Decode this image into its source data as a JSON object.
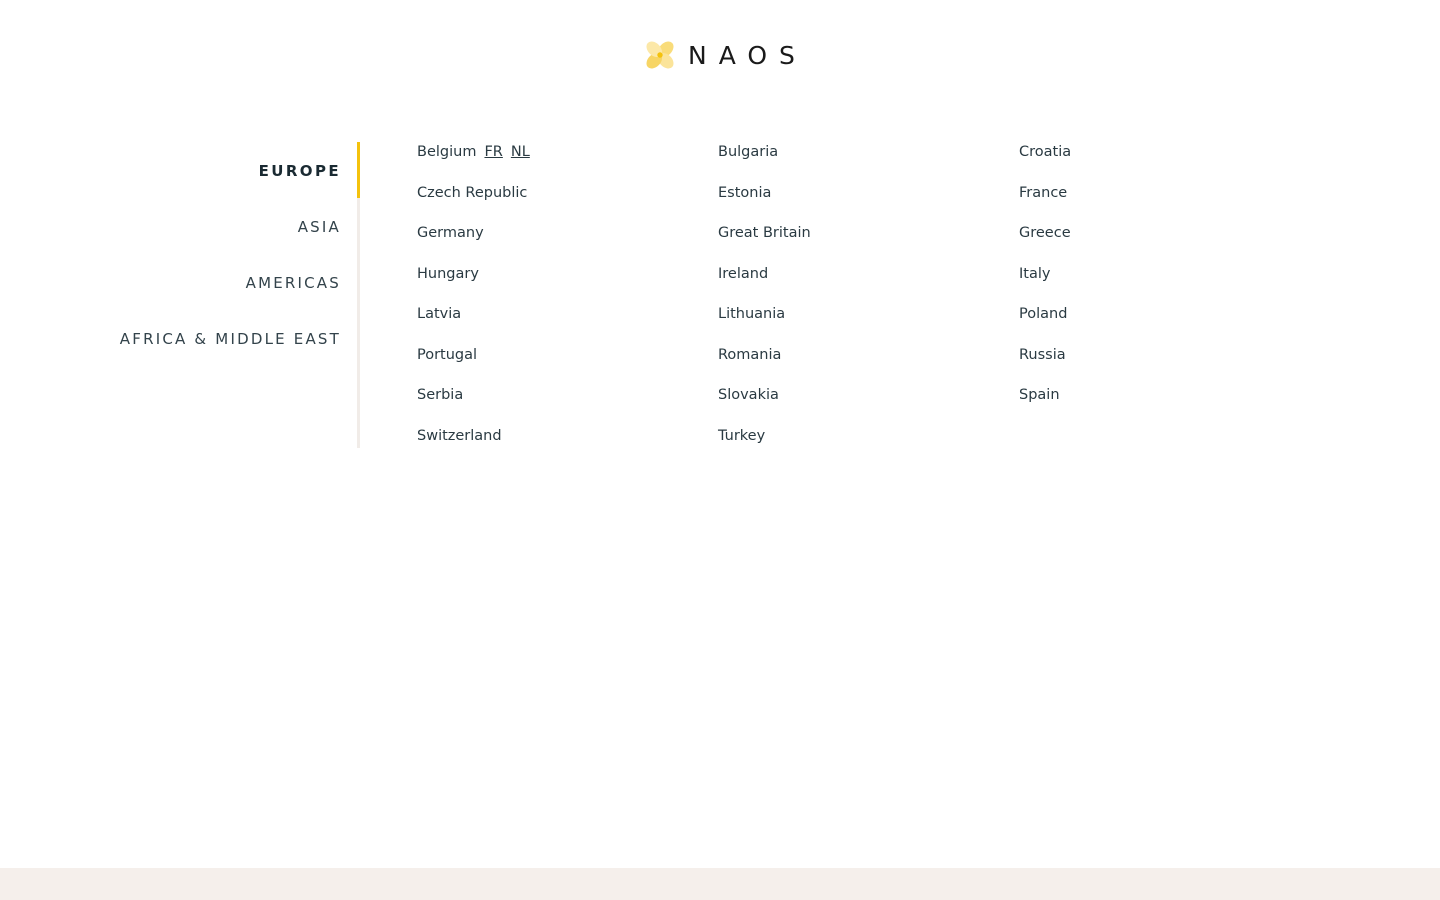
{
  "brand": {
    "name": "NAOS",
    "logo_icon": "flower-icon",
    "accent_color": "#f4c20d"
  },
  "regions": [
    {
      "label": "EUROPE",
      "active": true
    },
    {
      "label": "ASIA",
      "active": false
    },
    {
      "label": "AMERICAS",
      "active": false
    },
    {
      "label": "AFRICA & MIDDLE EAST",
      "active": false
    }
  ],
  "countries": {
    "col1": [
      "Belgium",
      "Czech Republic",
      "Germany",
      "Hungary",
      "Latvia",
      "Portugal",
      "Serbia",
      "Switzerland"
    ],
    "col2": [
      "Bulgaria",
      "Estonia",
      "Great Britain",
      "Ireland",
      "Lithuania",
      "Romania",
      "Slovakia",
      "Turkey"
    ],
    "col3": [
      "Croatia",
      "France",
      "Greece",
      "Italy",
      "Poland",
      "Russia",
      "Spain"
    ]
  },
  "belgium_languages": [
    "FR",
    "NL"
  ]
}
